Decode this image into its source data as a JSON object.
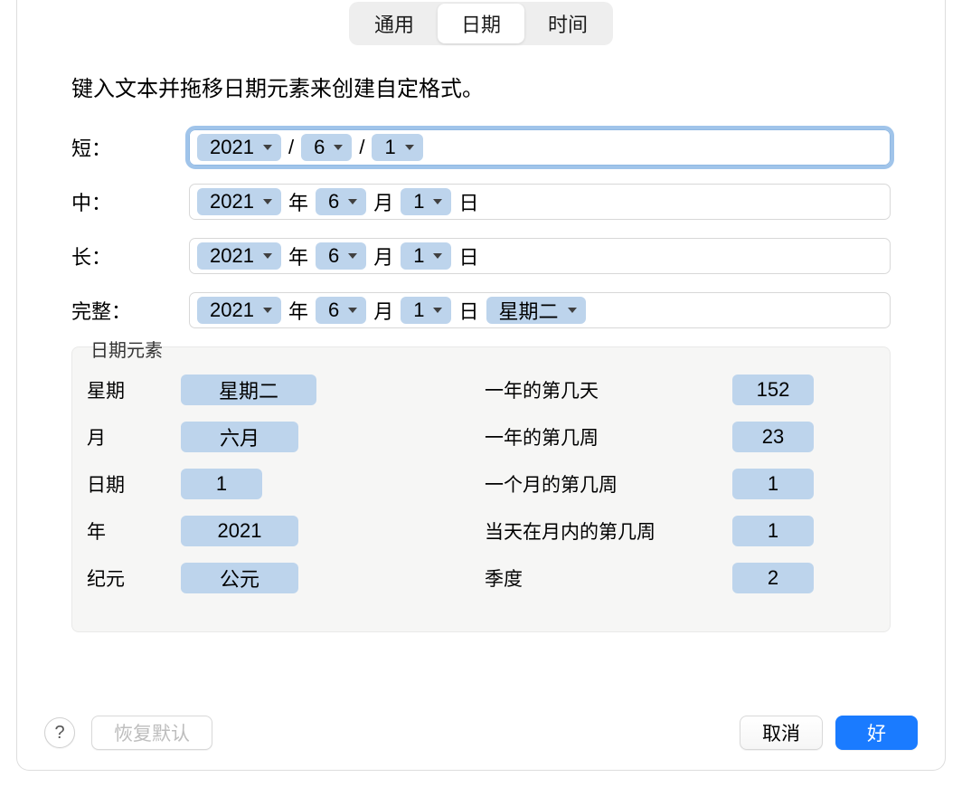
{
  "tabs": {
    "general": "通用",
    "date": "日期",
    "time": "时间",
    "active": "date"
  },
  "intro": "键入文本并拖移日期元素来创建自定格式。",
  "labels": {
    "short": "短：",
    "medium": "中：",
    "long": "长：",
    "full": "完整："
  },
  "sample": {
    "year": "2021",
    "month": "6",
    "day": "1",
    "year_suffix": "年",
    "month_suffix": "月",
    "day_suffix": "日",
    "slash": "/",
    "weekday": "星期二"
  },
  "elements": {
    "title": "日期元素",
    "left": {
      "weekday_label": "星期",
      "weekday_value": "星期二",
      "month_label": "月",
      "month_value": "六月",
      "date_label": "日期",
      "date_value": "1",
      "year_label": "年",
      "year_value": "2021",
      "era_label": "纪元",
      "era_value": "公元"
    },
    "right": {
      "doy_label": "一年的第几天",
      "doy_value": "152",
      "woy_label": "一年的第几周",
      "woy_value": "23",
      "wom_label": "一个月的第几周",
      "wom_value": "1",
      "dow_in_month_label": "当天在月内的第几周",
      "dow_in_month_value": "1",
      "quarter_label": "季度",
      "quarter_value": "2"
    }
  },
  "footer": {
    "help": "?",
    "restore": "恢复默认",
    "cancel": "取消",
    "ok": "好"
  }
}
